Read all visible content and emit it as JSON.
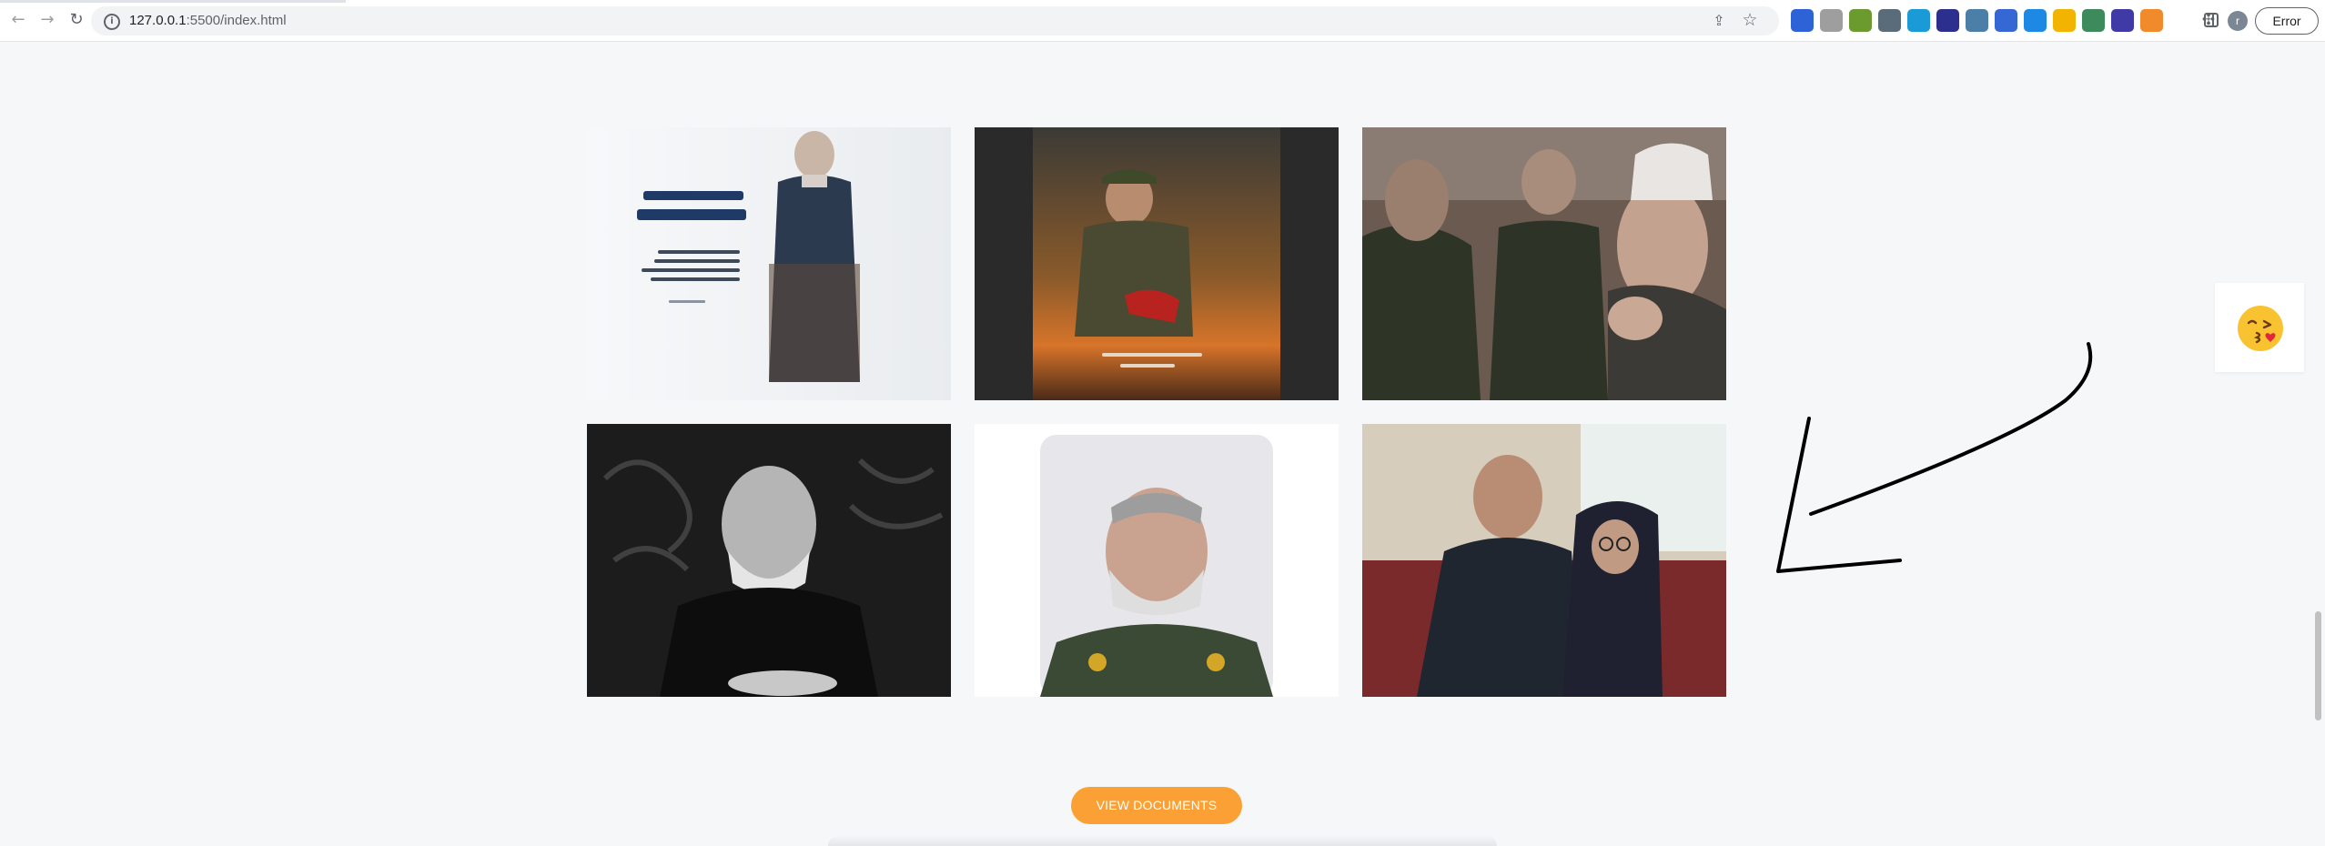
{
  "browser": {
    "url_host": "127.0.0.1",
    "url_path": ":5500/index.html",
    "profile_initial": "r",
    "error_label": "Error"
  },
  "gallery": {
    "items": [
      {
        "name": "poster-arabic-calligraphy"
      },
      {
        "name": "soldier-poster"
      },
      {
        "name": "officers-praying"
      },
      {
        "name": "bw-portrait"
      },
      {
        "name": "smiling-portrait"
      },
      {
        "name": "with-elderly-woman"
      }
    ]
  },
  "cta": {
    "label": "VIEW DOCUMENTS"
  },
  "colors": {
    "accent": "#fba034",
    "background": "#f6f7f9"
  }
}
